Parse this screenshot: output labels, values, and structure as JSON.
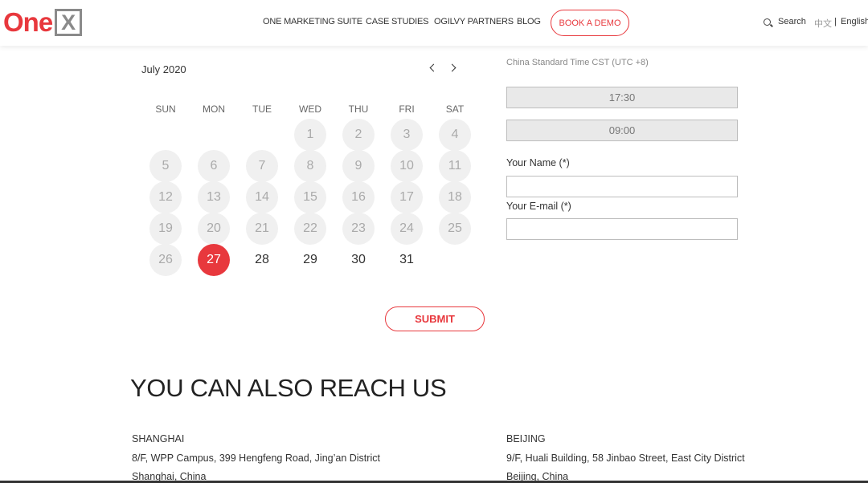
{
  "header": {
    "logo": {
      "one": "One",
      "x": "X"
    },
    "nav": [
      {
        "label": "ONE MARKETING SUITE"
      },
      {
        "label": "CASE STUDIES"
      },
      {
        "label": "OGILVY PARTNERS"
      },
      {
        "label": "BLOG"
      }
    ],
    "demo_button": "BOOK A DEMO",
    "search_label": "Search",
    "lang_zh": "中文",
    "lang_sep": "|",
    "lang_en": "English",
    "accent_color": "#e8383d"
  },
  "calendar": {
    "month_label": "July  2020",
    "weekdays": [
      "SUN",
      "MON",
      "TUE",
      "WED",
      "THU",
      "FRI",
      "SAT"
    ],
    "first_weekday_index": 3,
    "days_in_month": 31,
    "selected_day": 27
  },
  "booking": {
    "timezone": "China Standard Time CST (UTC +8)",
    "slots": [
      "17:30",
      "09:00"
    ],
    "name_label": "Your Name (*)",
    "name_value": "",
    "email_label": "Your E-mail (*)",
    "email_value": "",
    "submit_label": "SUBMIT"
  },
  "reach": {
    "heading": "YOU CAN ALSO REACH US",
    "offices": [
      {
        "title": "SHANGHAI",
        "line1": "8/F, WPP Campus, 399 Hengfeng Road, Jing’an District",
        "line2": "Shanghai, China"
      },
      {
        "title": "BEIJING",
        "line1": "9/F, Huali Building, 58 Jinbao Street, East City District",
        "line2": "Beijing, China"
      }
    ]
  }
}
